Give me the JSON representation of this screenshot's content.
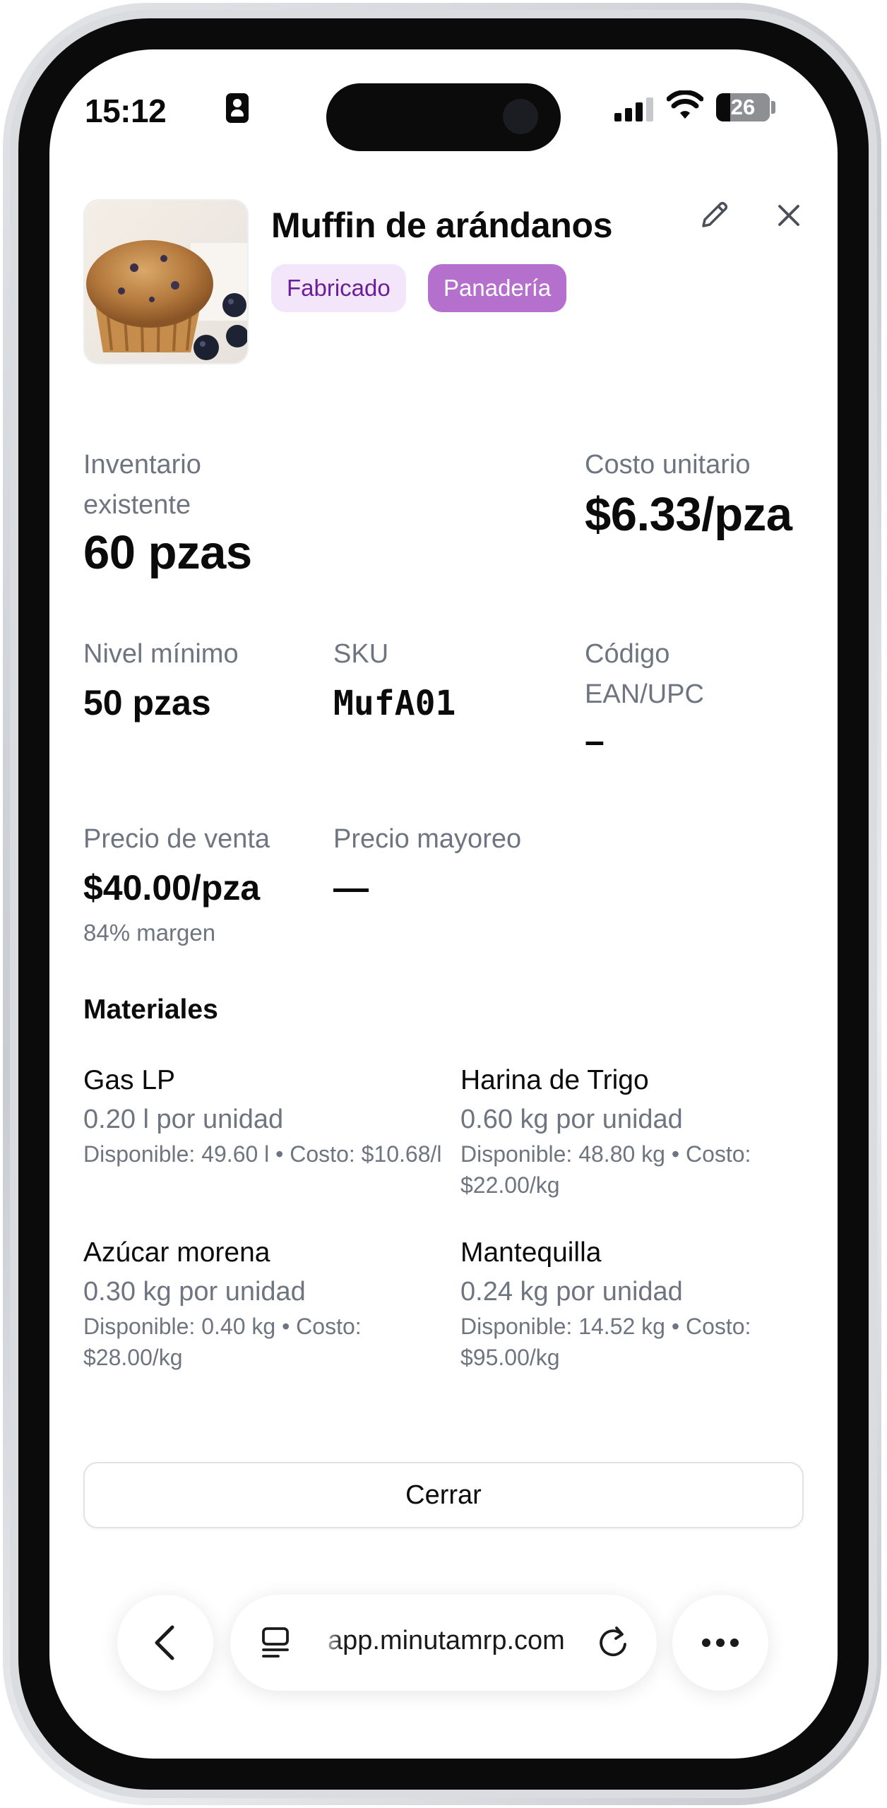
{
  "status_bar": {
    "time": "15:12",
    "battery": "26",
    "battery_level": 0.26
  },
  "product": {
    "title": "Muffin de arándanos",
    "badges": [
      "Fabricado",
      "Panadería"
    ]
  },
  "stats": {
    "inventory_label": "Inventario existente",
    "inventory_value": "60 pzas",
    "unit_cost_label": "Costo unitario",
    "unit_cost_value": "$6.33/pza",
    "min_level_label": "Nivel mínimo",
    "min_level_value": "50 pzas",
    "sku_label": "SKU",
    "sku_value": "MufA01",
    "ean_label": "Código EAN/UPC",
    "ean_value": "–",
    "sale_price_label": "Precio de venta",
    "sale_price_value": "$40.00/pza",
    "margin": "84% margen",
    "wholesale_label": "Precio mayoreo",
    "wholesale_value": "—"
  },
  "materials": {
    "title": "Materiales",
    "items": [
      {
        "name": "Gas LP",
        "qty": "0.20 l por unidad",
        "info": "Disponible: 49.60 l • Costo: $10.68/l"
      },
      {
        "name": "Harina de Trigo",
        "qty": "0.60 kg por unidad",
        "info": "Disponible: 48.80 kg • Costo: $22.00/kg"
      },
      {
        "name": "Azúcar morena",
        "qty": "0.30 kg por unidad",
        "info": "Disponible: 0.40 kg • Costo: $28.00/kg"
      },
      {
        "name": "Mantequilla",
        "qty": "0.24 kg por unidad",
        "info": "Disponible: 14.52 kg • Costo: $95.00/kg"
      }
    ]
  },
  "actions": {
    "close_label": "Cerrar"
  },
  "browser": {
    "url": "app.minutamrp.com",
    "icons": [
      "back-icon",
      "tabs-icon",
      "reload-icon",
      "more-icon"
    ]
  },
  "colors": {
    "badge_fabricado_bg": "#f3e6fb",
    "badge_fabricado_text": "#6b1e98",
    "badge_panaderia_bg": "#b56fcd",
    "muted_text": "#6f7580"
  }
}
